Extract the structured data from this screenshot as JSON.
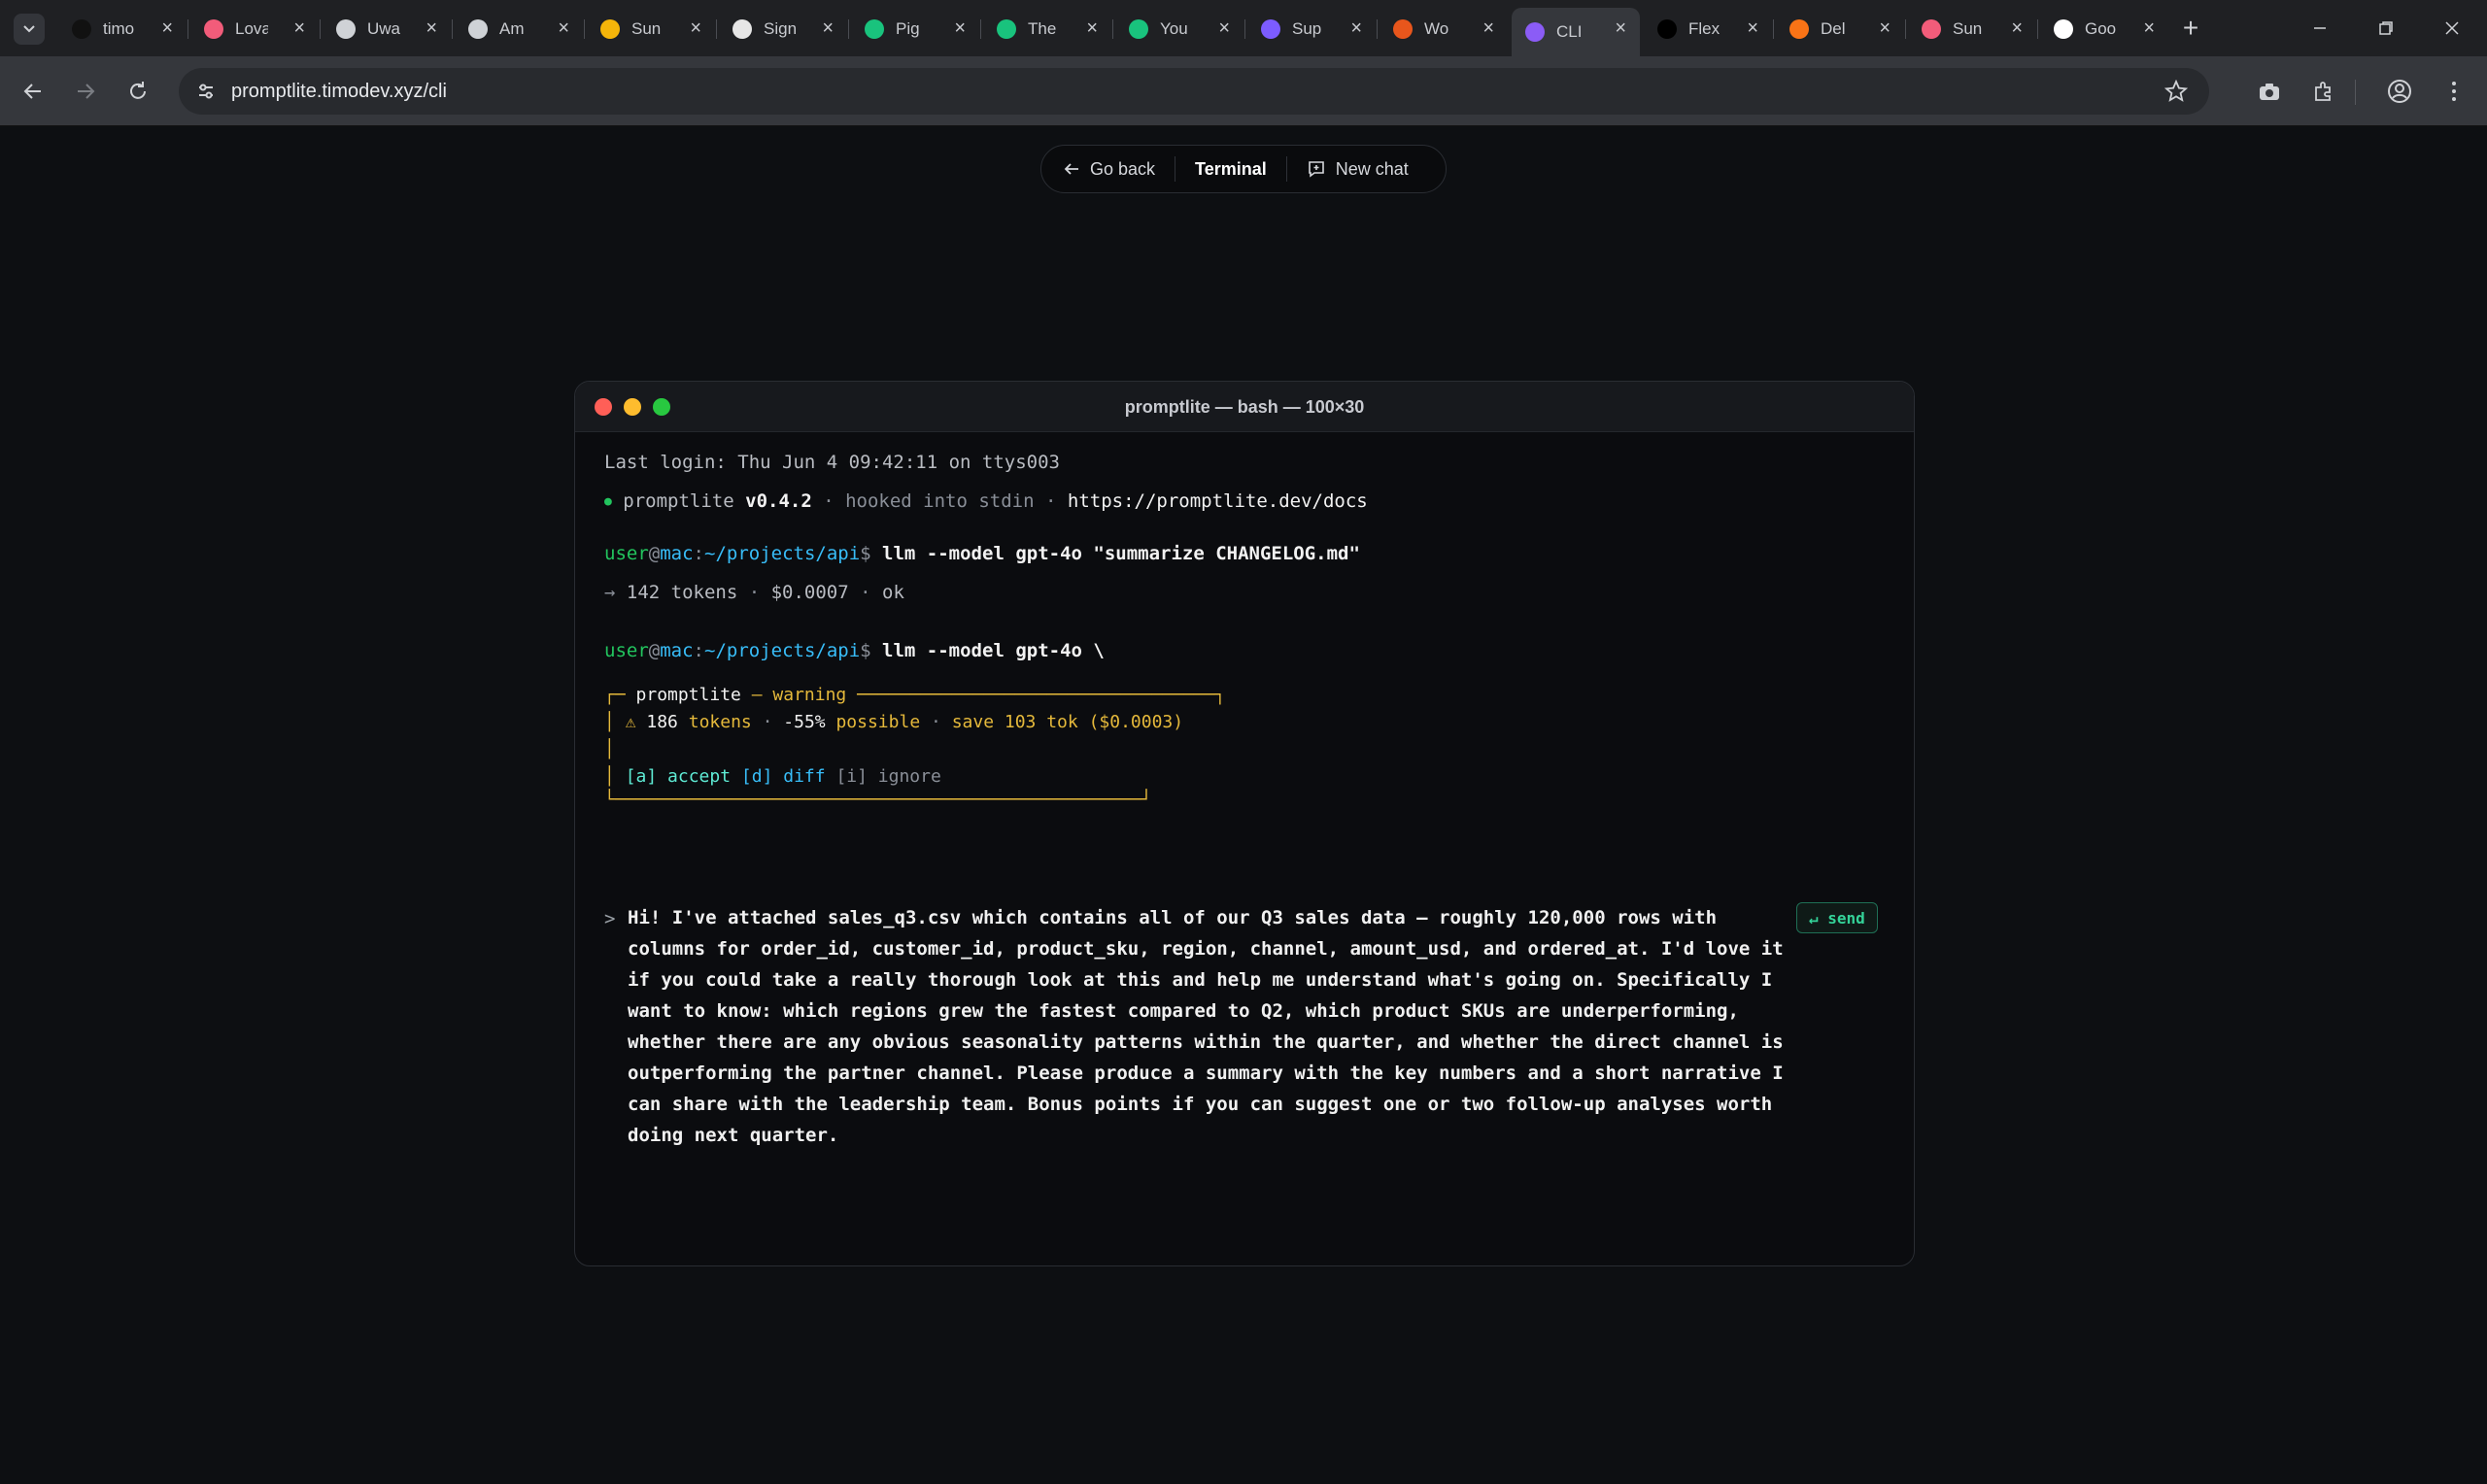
{
  "browser": {
    "tabs": [
      {
        "title": "timo",
        "favicon": "black-circle-logo",
        "color": "#111111"
      },
      {
        "title": "Lovable",
        "favicon": "heart-gradient-logo",
        "color": "#f25c7a"
      },
      {
        "title": "Uwa",
        "favicon": "sparkle-logo",
        "color": "#cfd2d6"
      },
      {
        "title": "Am",
        "favicon": "sparkle-logo",
        "color": "#cfd2d6"
      },
      {
        "title": "Sun",
        "favicon": "sun-logo",
        "color": "#f5b50a"
      },
      {
        "title": "Sign",
        "favicon": "chatgpt-logo",
        "color": "#e6e6e6"
      },
      {
        "title": "Pig",
        "favicon": "chatgpt-green-logo",
        "color": "#19c37d"
      },
      {
        "title": "The",
        "favicon": "chatgpt-green-logo",
        "color": "#19c37d"
      },
      {
        "title": "You",
        "favicon": "chatgpt-green-logo",
        "color": "#19c37d"
      },
      {
        "title": "Sup",
        "favicon": "s-logo",
        "color": "#7c5cff"
      },
      {
        "title": "Wo",
        "favicon": "w-logo",
        "color": "#e8561c"
      },
      {
        "title": "CLI",
        "favicon": "window-logo",
        "color": "#8b5cf6"
      },
      {
        "title": "Flex",
        "favicon": "flex-logo",
        "color": "#000000"
      },
      {
        "title": "Del",
        "favicon": "d-logo",
        "color": "#f97316"
      },
      {
        "title": "Sun",
        "favicon": "heart-gradient-logo",
        "color": "#f25c7a"
      },
      {
        "title": "Goo",
        "favicon": "google-logo",
        "color": "#ffffff"
      }
    ],
    "active_tab_index": 11,
    "url": "promptlite.timodev.xyz/cli"
  },
  "page_nav": {
    "go_back": "Go back",
    "terminal": "Terminal",
    "new_chat": "New chat"
  },
  "terminal": {
    "title": "promptlite — bash — 100×30",
    "last_login": "Last login: Thu Jun 4 09:42:11 on ttys003",
    "status": {
      "bullet": "●",
      "app": "promptlite",
      "version": "v0.4.2",
      "sep1": " · ",
      "hooked": "hooked into stdin",
      "sep2": " · ",
      "docs_url": "https://promptlite.dev/docs"
    },
    "prompt": {
      "user": "user",
      "at": "@",
      "host": "mac",
      "colon": ":",
      "path": "~/projects/api",
      "dollar": "$"
    },
    "cmd1": " llm --model gpt-4o \"summarize CHANGELOG.md\"",
    "result1": {
      "arrow": "→ ",
      "tokens": "142 tokens",
      "sep1": " · ",
      "cost": "$0.0007",
      "sep2": " · ",
      "status": "ok"
    },
    "cmd2": " llm --model gpt-4o \\",
    "warning": {
      "header_prefix": "┌─ ",
      "app": "promptlite",
      "dash": " — ",
      "label": "warning",
      "header_rule": " ──────────────────────────────────┐",
      "icon": "⚠",
      "count": "186",
      "tokens_word": " tokens",
      "sep1": " · ",
      "pct": "-55%",
      "possible": " possible",
      "sep2": " · ",
      "save_text": "save 103 tok ($0.0003)",
      "accept": "[a] accept",
      "diff": "[d] diff",
      "ignore": "[i] ignore"
    },
    "input": {
      "caret": ">",
      "text": "Hi! I've attached sales_q3.csv which contains all of our Q3 sales data — roughly 120,000 rows with columns for order_id, customer_id, product_sku, region, channel, amount_usd, and ordered_at. I'd love it if you could take a really thorough look at this and help me understand what's going on. Specifically I want to know: which regions grew the fastest compared to Q2, which product SKUs are underperforming, whether there are any obvious seasonality patterns within the quarter, and whether the direct channel is outperforming the partner channel. Please produce a summary with the key numbers and a short narrative I can share with the leadership team. Bonus points if you can suggest one or two follow-up analyses worth doing next quarter.",
      "send_label": "↵ send"
    }
  }
}
